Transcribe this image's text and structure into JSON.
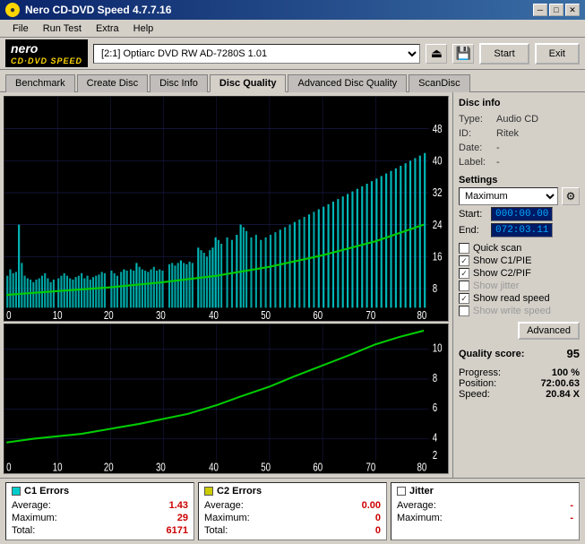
{
  "window": {
    "title": "Nero CD-DVD Speed 4.7.7.16",
    "icon": "●"
  },
  "titlebar": {
    "min": "─",
    "max": "□",
    "close": "✕"
  },
  "menu": {
    "items": [
      "File",
      "Run Test",
      "Extra",
      "Help"
    ]
  },
  "toolbar": {
    "logo_top": "nero",
    "logo_bottom": "CD·DVD SPEED",
    "drive": "[2:1]  Optiarc DVD RW AD-7280S 1.01",
    "start_label": "Start",
    "exit_label": "Exit"
  },
  "tabs": [
    {
      "label": "Benchmark",
      "active": false
    },
    {
      "label": "Create Disc",
      "active": false
    },
    {
      "label": "Disc Info",
      "active": false
    },
    {
      "label": "Disc Quality",
      "active": true
    },
    {
      "label": "Advanced Disc Quality",
      "active": false
    },
    {
      "label": "ScanDisc",
      "active": false
    }
  ],
  "disc_info": {
    "section_title": "Disc info",
    "type_label": "Type:",
    "type_value": "Audio CD",
    "id_label": "ID:",
    "id_value": "Ritek",
    "date_label": "Date:",
    "date_value": "-",
    "label_label": "Label:",
    "label_value": "-"
  },
  "settings": {
    "section_title": "Settings",
    "dropdown_value": "Maximum",
    "start_label": "Start:",
    "start_value": "000:00.00",
    "end_label": "End:",
    "end_value": "072:03.11"
  },
  "checkboxes": [
    {
      "label": "Quick scan",
      "checked": false,
      "enabled": true
    },
    {
      "label": "Show C1/PIE",
      "checked": true,
      "enabled": true
    },
    {
      "label": "Show C2/PIF",
      "checked": true,
      "enabled": true
    },
    {
      "label": "Show jitter",
      "checked": false,
      "enabled": false
    },
    {
      "label": "Show read speed",
      "checked": true,
      "enabled": true
    },
    {
      "label": "Show write speed",
      "checked": false,
      "enabled": false
    }
  ],
  "advanced_btn": "Advanced",
  "quality": {
    "label": "Quality score:",
    "value": "95"
  },
  "progress": {
    "progress_label": "Progress:",
    "progress_value": "100 %",
    "position_label": "Position:",
    "position_value": "72:00.63",
    "speed_label": "Speed:",
    "speed_value": "20.84 X"
  },
  "stats": {
    "c1": {
      "label": "C1 Errors",
      "color": "#00cccc",
      "avg_label": "Average:",
      "avg_value": "1.43",
      "max_label": "Maximum:",
      "max_value": "29",
      "total_label": "Total:",
      "total_value": "6171"
    },
    "c2": {
      "label": "C2 Errors",
      "color": "#cccc00",
      "avg_label": "Average:",
      "avg_value": "0.00",
      "max_label": "Maximum:",
      "max_value": "0",
      "total_label": "Total:",
      "total_value": "0"
    },
    "jitter": {
      "label": "Jitter",
      "color": "#ffffff",
      "avg_label": "Average:",
      "avg_value": "-",
      "max_label": "Maximum:",
      "max_value": "-",
      "total_label": "",
      "total_value": ""
    }
  },
  "main_chart": {
    "y_labels": [
      "48",
      "40",
      "32",
      "24",
      "16",
      "8"
    ],
    "x_labels": [
      "0",
      "10",
      "20",
      "30",
      "40",
      "50",
      "60",
      "70",
      "80"
    ]
  },
  "secondary_chart": {
    "y_labels": [
      "10",
      "8",
      "6",
      "4",
      "2"
    ],
    "x_labels": [
      "0",
      "10",
      "20",
      "30",
      "40",
      "50",
      "60",
      "70",
      "80"
    ]
  }
}
